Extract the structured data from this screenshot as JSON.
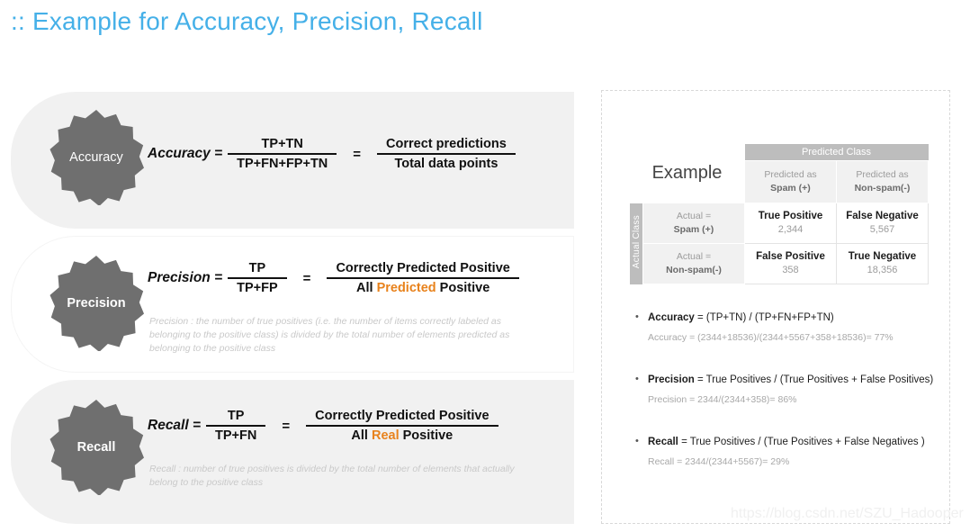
{
  "slide": {
    "title": ":: Example for Accuracy, Precision, Recall",
    "title_color": "#45b0e8",
    "watermark": "https://blog.csdn.net/SZU_Hadooper"
  },
  "metrics": [
    {
      "badge_label": "Accuracy",
      "name": "Accuracy =",
      "numerator": "TP+TN",
      "denominator": "TP+FN+FP+TN",
      "equals": "=",
      "result_numerator": "Correct predictions",
      "result_denominator_pre": "Total data points",
      "result_denominator_hl": "",
      "result_denominator_post": "",
      "description": ""
    },
    {
      "badge_label": "Precision",
      "name": "Precision =",
      "numerator": "TP",
      "denominator": "TP+FP",
      "equals": "=",
      "result_numerator": "Correctly Predicted Positive",
      "result_denominator_pre": "All ",
      "result_denominator_hl": "Predicted",
      "result_denominator_post": " Positive",
      "description": "Precision : the number of true positives (i.e. the number of items correctly labeled as belonging to the positive class) is divided by the total number of elements predicted as belonging to the positive class"
    },
    {
      "badge_label": "Recall",
      "name": "Recall =",
      "numerator": "TP",
      "denominator": "TP+FN",
      "equals": "=",
      "result_numerator": "Correctly Predicted Positive",
      "result_denominator_pre": "All ",
      "result_denominator_hl": "Real",
      "result_denominator_post": " Positive",
      "description": "Recall : number of true positives  is divided by the total number of elements that actually belong to the positive class"
    }
  ],
  "confusion_matrix": {
    "title": "Example",
    "predicted_class_header": "Predicted Class",
    "actual_class_header": "Actual Class",
    "col_headers": [
      {
        "line1": "Predicted as",
        "line2": "Spam (+)"
      },
      {
        "line1": "Predicted as",
        "line2": "Non-spam(-)"
      }
    ],
    "row_headers": [
      {
        "line1": "Actual =",
        "line2": "Spam (+)"
      },
      {
        "line1": "Actual =",
        "line2": "Non-spam(-)"
      }
    ],
    "cells": [
      [
        {
          "label": "True Positive",
          "value": "2,344"
        },
        {
          "label": "False Negative",
          "value": "5,567"
        }
      ],
      [
        {
          "label": "False Positive",
          "value": "358"
        },
        {
          "label": "True Negative",
          "value": "18,356"
        }
      ]
    ]
  },
  "bullets": [
    {
      "term": "Accuracy",
      "formula": " = (TP+TN) / (TP+FN+FP+TN)",
      "calculation": "Accuracy = (2344+18536)/(2344+5567+358+18536)= 77%"
    },
    {
      "term": "Precision",
      "formula": " = True Positives / (True Positives + False Positives)",
      "calculation": "Precision = 2344/(2344+358)= 86%"
    },
    {
      "term": "Recall",
      "formula": " = True Positives / (True Positives + False Negatives )",
      "calculation": "Recall = 2344/(2344+5567)= 29%"
    }
  ]
}
